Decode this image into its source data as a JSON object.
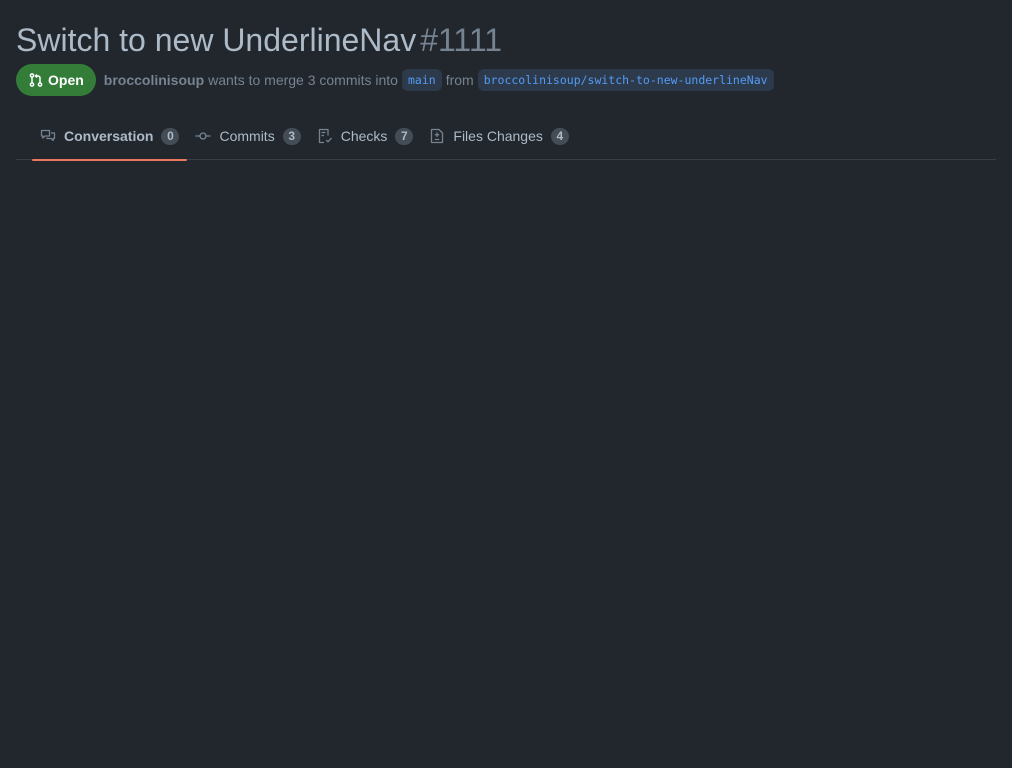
{
  "pull_request": {
    "title": "Switch to new UnderlineNav",
    "number": "#1111",
    "state_label": "Open",
    "author": "broccolinisoup",
    "merge_text": "wants to merge 3 commits into",
    "base_branch": "main",
    "from_text": "from",
    "head_branch": "broccolinisoup/switch-to-new-underlineNav"
  },
  "tabs": [
    {
      "label": "Conversation",
      "count": "0",
      "icon": "comment-discussion-icon",
      "selected": true
    },
    {
      "label": "Commits",
      "count": "3",
      "icon": "git-commit-icon",
      "selected": false
    },
    {
      "label": "Checks",
      "count": "7",
      "icon": "checklist-icon",
      "selected": false
    },
    {
      "label": "Files Changes",
      "count": "4",
      "icon": "file-diff-icon",
      "selected": false
    }
  ],
  "colors": {
    "background": "#22272e",
    "open_badge": "#347d39",
    "selected_underline": "#ec775c",
    "branch_text": "#539bf5"
  }
}
